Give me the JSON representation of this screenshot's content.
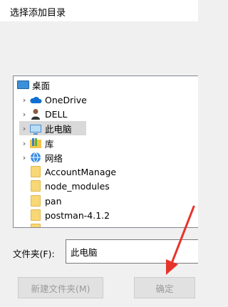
{
  "dialog": {
    "title": "选择添加目录"
  },
  "tree": {
    "items": [
      {
        "label": "桌面",
        "icon": "desktop-icon",
        "indent": 0
      },
      {
        "label": "OneDrive",
        "icon": "cloud-icon",
        "indent": 1,
        "expandable": true
      },
      {
        "label": "DELL",
        "icon": "user-icon",
        "indent": 1,
        "expandable": true
      },
      {
        "label": "此电脑",
        "icon": "computer-icon",
        "indent": 1,
        "expandable": true,
        "selected": true
      },
      {
        "label": "库",
        "icon": "library-icon",
        "indent": 1,
        "expandable": true
      },
      {
        "label": "网络",
        "icon": "network-icon",
        "indent": 1,
        "expandable": true
      },
      {
        "label": "AccountManage",
        "icon": "folder-icon",
        "indent": 1
      },
      {
        "label": "node_modules",
        "icon": "folder-icon",
        "indent": 1
      },
      {
        "label": "pan",
        "icon": "folder-icon",
        "indent": 1
      },
      {
        "label": "postman-4.1.2",
        "icon": "folder-icon",
        "indent": 1
      }
    ]
  },
  "folder_field": {
    "label": "文件夹(F):",
    "value": "此电脑"
  },
  "buttons": {
    "new_folder": "新建文件夹(M)",
    "ok": "确定"
  },
  "colors": {
    "selection": "#d9d9d9",
    "arrow": "#e8332a",
    "folder": "#f8d775"
  }
}
